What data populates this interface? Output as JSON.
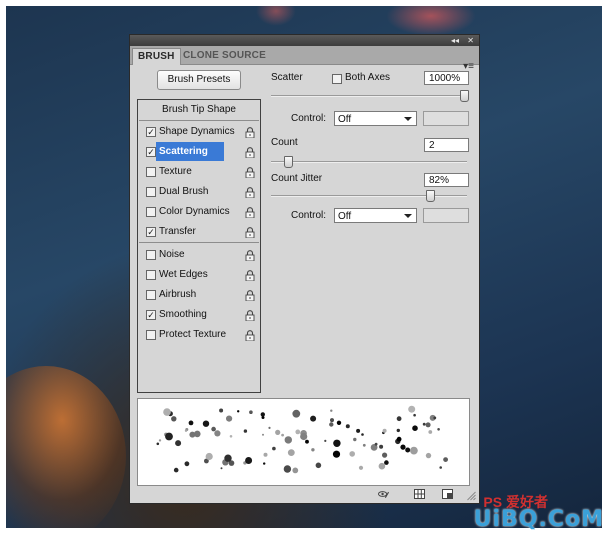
{
  "panel": {
    "tabs": [
      {
        "label": "BRUSH",
        "active": true
      },
      {
        "label": "CLONE SOURCE",
        "active": false
      }
    ],
    "brush_presets_label": "Brush Presets",
    "tip_shape_label": "Brush Tip Shape",
    "options": [
      {
        "label": "Shape Dynamics",
        "checked": true,
        "selected": false
      },
      {
        "label": "Scattering",
        "checked": true,
        "selected": true
      },
      {
        "label": "Texture",
        "checked": false,
        "selected": false
      },
      {
        "label": "Dual Brush",
        "checked": false,
        "selected": false
      },
      {
        "label": "Color Dynamics",
        "checked": false,
        "selected": false
      },
      {
        "label": "Transfer",
        "checked": true,
        "selected": false
      },
      {
        "label": "Noise",
        "checked": false,
        "selected": false
      },
      {
        "label": "Wet Edges",
        "checked": false,
        "selected": false
      },
      {
        "label": "Airbrush",
        "checked": false,
        "selected": false
      },
      {
        "label": "Smoothing",
        "checked": true,
        "selected": false
      },
      {
        "label": "Protect Texture",
        "checked": false,
        "selected": false
      }
    ],
    "scatter": {
      "label": "Scatter",
      "both_axes_label": "Both Axes",
      "both_axes_checked": false,
      "value": "1000%",
      "slider_fraction": 1.0,
      "control_label": "Control:",
      "control_value": "Off"
    },
    "count": {
      "label": "Count",
      "value": "2",
      "slider_fraction": 0.07
    },
    "count_jitter": {
      "label": "Count Jitter",
      "value": "82%",
      "slider_fraction": 0.82,
      "control_label": "Control:",
      "control_value": "Off"
    }
  },
  "watermark": {
    "text": "UiBQ.CoM",
    "sub_text": "PS 爱好者"
  },
  "icons": {
    "collapse": "double-chevron-left-icon",
    "close": "close-icon",
    "panel_menu": "panel-menu-icon",
    "lock": "lock-icon",
    "toggle_preview": "eye-brush-icon",
    "grid": "grid-icon",
    "new_preset": "new-preset-icon",
    "resize": "resize-grip-icon"
  }
}
